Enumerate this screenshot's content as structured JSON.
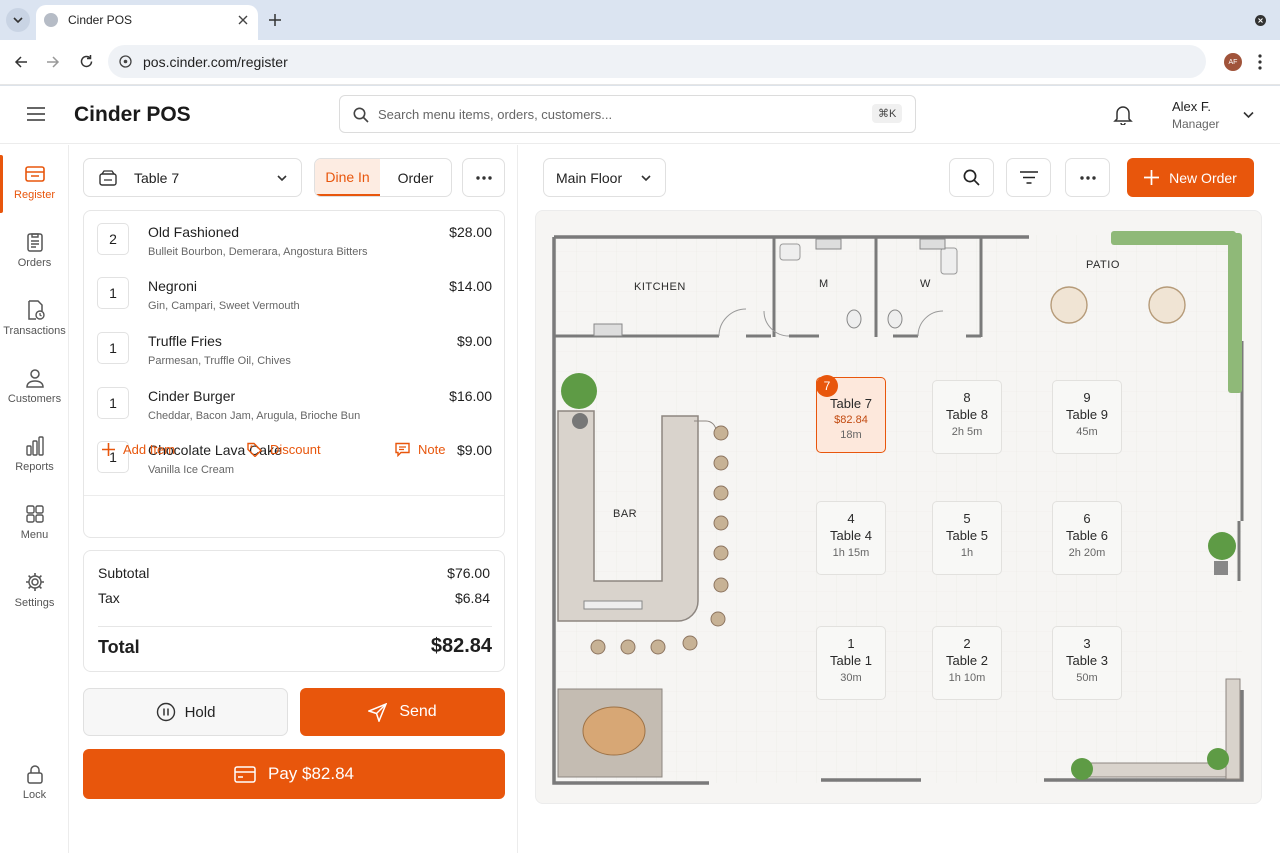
{
  "browser": {
    "tab_title": "Cinder POS",
    "url": "pos.cinder.com/register",
    "profile_initials": "AF"
  },
  "header": {
    "app_title": "Cinder POS",
    "search_placeholder": "Search menu items, orders, customers...",
    "shortcut": "⌘K",
    "user_name": "Alex F.",
    "user_role": "Manager"
  },
  "nav": {
    "items": [
      {
        "label": "Register",
        "icon": "register-icon"
      },
      {
        "label": "Orders",
        "icon": "clipboard-icon"
      },
      {
        "label": "Transactions",
        "icon": "receipt-clock-icon"
      },
      {
        "label": "Customers",
        "icon": "person-icon"
      },
      {
        "label": "Reports",
        "icon": "bar-chart-icon"
      },
      {
        "label": "Menu",
        "icon": "grid-icon"
      },
      {
        "label": "Settings",
        "icon": "gear-icon"
      }
    ],
    "lock_label": "Lock"
  },
  "order": {
    "table_select": "Table 7",
    "mode_tabs": [
      {
        "label": "Dine In",
        "active": true
      },
      {
        "label": "Order",
        "active": false
      }
    ],
    "items": [
      {
        "qty": "2",
        "name": "Old Fashioned",
        "desc": "Bulleit Bourbon, Demerara, Angostura Bitters",
        "price": "$28.00"
      },
      {
        "qty": "1",
        "name": "Negroni",
        "desc": "Gin, Campari, Sweet Vermouth",
        "price": "$14.00"
      },
      {
        "qty": "1",
        "name": "Truffle Fries",
        "desc": "Parmesan, Truffle Oil, Chives",
        "price": "$9.00"
      },
      {
        "qty": "1",
        "name": "Cinder Burger",
        "desc": "Cheddar, Bacon Jam, Arugula, Brioche Bun",
        "price": "$16.00"
      },
      {
        "qty": "1",
        "name": "Chocolate Lava Cake",
        "desc": "Vanilla Ice Cream",
        "price": "$9.00"
      }
    ],
    "actions": {
      "add_item": "Add Item",
      "discount": "Discount",
      "note": "Note"
    },
    "summary": {
      "subtotal_label": "Subtotal",
      "subtotal": "$76.00",
      "tax_label": "Tax",
      "tax": "$6.84",
      "total_label": "Total",
      "total": "$82.84"
    },
    "hold_label": "Hold",
    "send_label": "Send",
    "pay_label": "Pay $82.84"
  },
  "floor": {
    "floor_select": "Main Floor",
    "new_order_label": "New Order",
    "rooms": {
      "kitchen": "KITCHEN",
      "mens": "M",
      "womens": "W",
      "patio": "PATIO",
      "bar": "BAR"
    },
    "tables": [
      {
        "number": "7",
        "label": "Table 7",
        "amount": "$82.84",
        "time": "18m",
        "selected": true
      },
      {
        "number": "8",
        "label": "Table 8",
        "time": "2h 5m"
      },
      {
        "number": "9",
        "label": "Table 9",
        "time": "45m"
      },
      {
        "number": "4",
        "label": "Table 4",
        "time": "1h 15m"
      },
      {
        "number": "5",
        "label": "Table 5",
        "time": "1h"
      },
      {
        "number": "6",
        "label": "Table 6",
        "time": "2h 20m"
      },
      {
        "number": "1",
        "label": "Table 1",
        "time": "30m"
      },
      {
        "number": "2",
        "label": "Table 2",
        "time": "1h 10m"
      },
      {
        "number": "3",
        "label": "Table 3",
        "time": "50m"
      }
    ]
  },
  "colors": {
    "accent": "#e8560c",
    "selected_table_bg": "#fde8dc"
  }
}
